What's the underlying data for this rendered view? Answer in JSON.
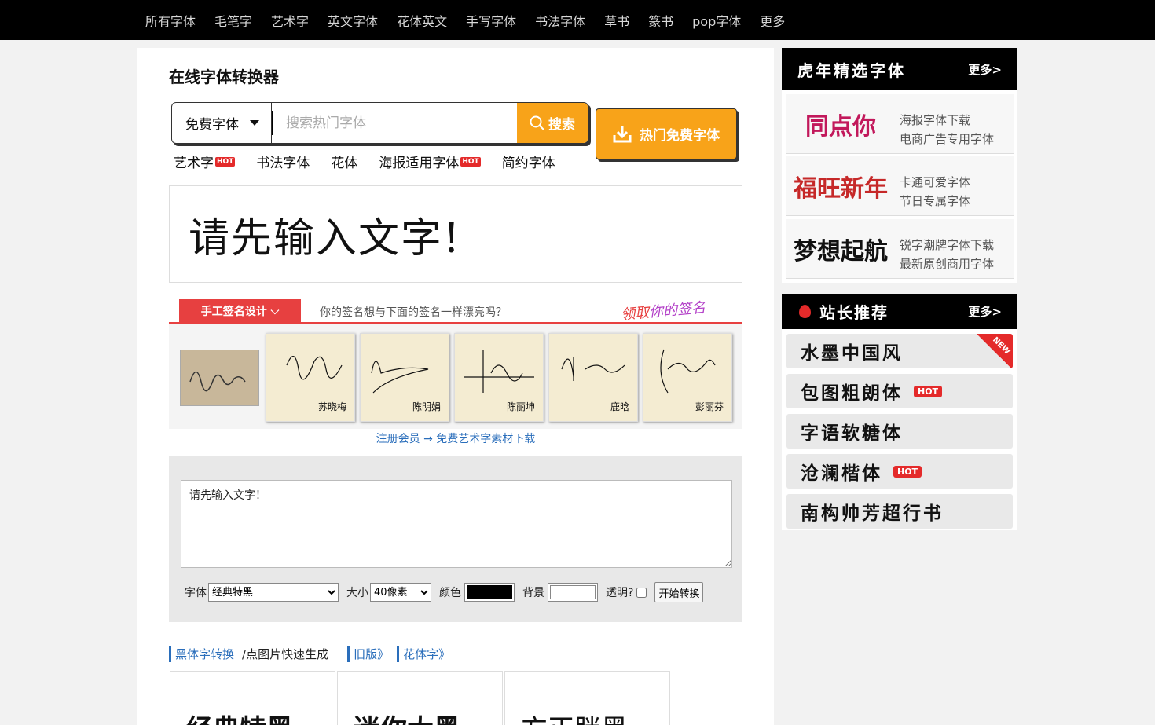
{
  "nav": [
    "所有字体",
    "毛笔字",
    "艺术字",
    "英文字体",
    "花体英文",
    "手写字体",
    "书法字体",
    "草书",
    "篆书",
    "pop字体",
    "更多"
  ],
  "title": "在线字体转换器",
  "search": {
    "category": "免费字体",
    "placeholder": "搜索热门字体",
    "button": "搜索"
  },
  "hot_button": "热门免费字体",
  "quick_links": [
    {
      "label": "艺术字",
      "hot": "HOT"
    },
    {
      "label": "书法字体",
      "hot": ""
    },
    {
      "label": "花体",
      "hot": ""
    },
    {
      "label": "海报适用字体",
      "hot": "HOT"
    },
    {
      "label": "简约字体",
      "hot": ""
    }
  ],
  "preview_text": "请先输入文字!",
  "signature": {
    "tab": "手工签名设计",
    "question": "你的签名想与下面的签名一样漂亮吗？",
    "get_prefix": "领取",
    "get_suffix": "你的签名",
    "names": [
      "苏晓梅",
      "陈明娟",
      "陈丽坤",
      "鹿晗",
      "彭丽芬"
    ]
  },
  "register_link": "注册会员 → 免费艺术字素材下载",
  "converter": {
    "text": "请先输入文字！",
    "font_label": "字体",
    "font_value": "经典特黑",
    "size_label": "大小",
    "size_value": "40像素",
    "color_label": "颜色",
    "bg_label": "背景",
    "transparent_label": "透明?",
    "submit": "开始转换",
    "fg_color": "#000000",
    "bg_color": "#ffffff"
  },
  "bottom_links": {
    "heiti": "黑体字转换",
    "tip": "/点图片快速生成",
    "old": "旧版》",
    "huati": "花体字》"
  },
  "samples": [
    "经典特黑",
    "迷你大黑",
    "方正胖黑"
  ],
  "sidebar": {
    "featured_title": "虎年精选字体",
    "more": "更多>",
    "ads": [
      {
        "img_text": "同点你",
        "l1": "海报字体下载",
        "l2": "电商广告专用字体",
        "color": "#c2185b"
      },
      {
        "img_text": "福旺新年",
        "l1": "卡通可爱字体",
        "l2": "节日专属字体",
        "color": "#c62828"
      },
      {
        "img_text": "梦想起航",
        "l1": "锐字潮牌字体下载",
        "l2": "最新原创商用字体",
        "color": "#111111"
      }
    ],
    "recommend_title": "站长推荐",
    "recommend_more": "更多>",
    "recs": [
      {
        "name": "水墨中国风",
        "hot": "",
        "new": "NEW"
      },
      {
        "name": "包图粗朗体",
        "hot": "HOT",
        "new": ""
      },
      {
        "name": "字语软糖体",
        "hot": "",
        "new": ""
      },
      {
        "name": "沧澜楷体",
        "hot": "HOT",
        "new": ""
      },
      {
        "name": "南构帅芳超行书",
        "hot": "",
        "new": ""
      }
    ]
  }
}
